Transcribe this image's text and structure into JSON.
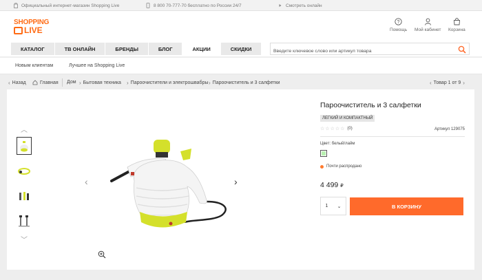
{
  "topbar": {
    "shop_label": "Официальный интернет-магазин Shopping Live",
    "phone": "8 800 70-777-70 бесплатно по России 24/7",
    "watch_label": "Смотреть онлайн"
  },
  "logo": {
    "line1": "SHOPPING",
    "line2": "LIVE"
  },
  "header": {
    "help": "Помощь",
    "cabinet": "Мой кабинет",
    "cart": "Корзина"
  },
  "nav": {
    "items": [
      "Каталог",
      "ТВ онлайн",
      "Бренды",
      "Блог",
      "Акции",
      "Скидки"
    ],
    "active": "Акции"
  },
  "search": {
    "placeholder": "Введите ключевое слово или артикул товара"
  },
  "subnav": {
    "new_clients": "Новым клиентам",
    "best": "Лучшее на Shopping Live"
  },
  "breadcrumb": {
    "back": "Назад",
    "home": "Главная",
    "items": [
      "Дом",
      "Бытовая техника",
      "Пароочистители и электрошвабры",
      "Пароочиститель и 3 салфетки"
    ],
    "counter": "Товар 1 от 9"
  },
  "product": {
    "title": "Пароочиститель и 3 салфетки",
    "tag": "ЛЕГКИЙ И КОМПАКТНЫЙ",
    "rating_count": "(0)",
    "article": "Артикул 129075",
    "color_label": "Цвет: белый/лайм",
    "availability": "Почти распродано",
    "price": "4 499",
    "currency": "₽",
    "qty": "1",
    "cart_button": "В КОРЗИНУ"
  },
  "colors": {
    "accent": "#ff6a2b",
    "swatch": "#b8f0b0",
    "lime": "#d4e02b"
  }
}
